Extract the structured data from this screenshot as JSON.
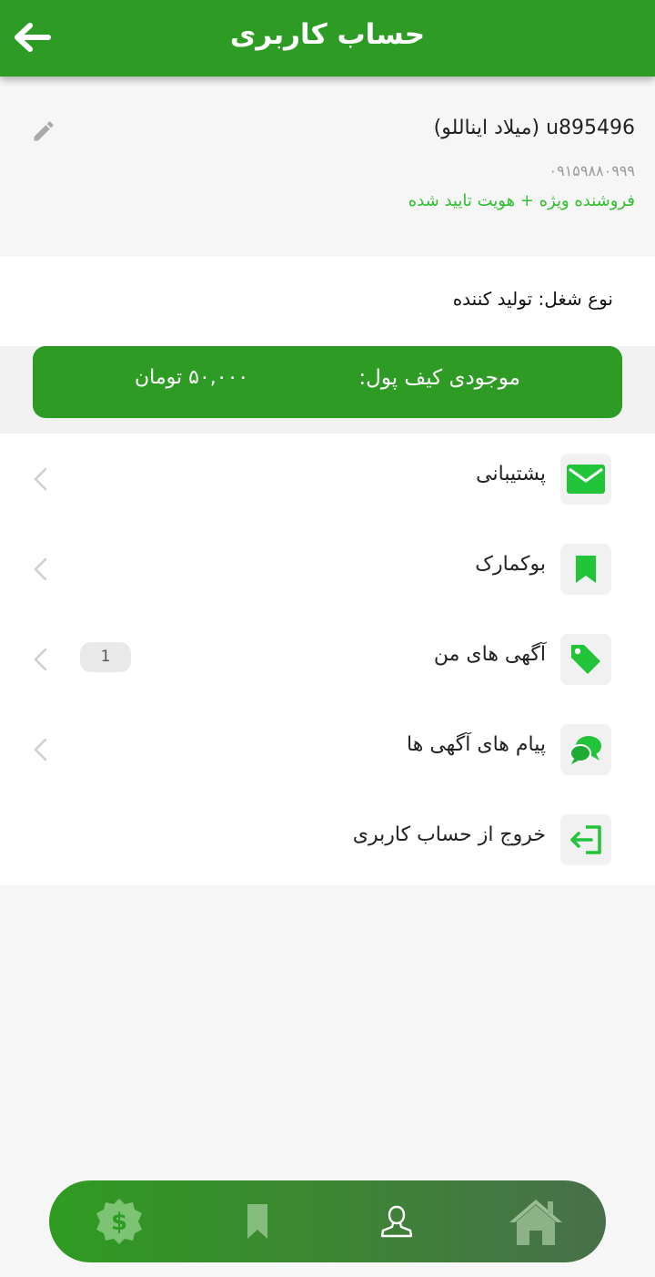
{
  "header": {
    "title": "حساب کاربری",
    "back_icon": "arrow-left-icon"
  },
  "profile": {
    "username_line": "u895496 (میلاد ایناللو)",
    "phone": "۰۹۱۵۹۸۸۰۹۹۹",
    "status": "فروشنده ویژه + هویت تایید شده",
    "edit_icon": "pencil-icon"
  },
  "job": {
    "text": "نوع شغل: تولید کننده"
  },
  "wallet": {
    "label": "موجودی کیف پول:",
    "amount": "۵۰,۰۰۰ تومان"
  },
  "menu": {
    "items": [
      {
        "label": "پشتیبانی",
        "icon": "mail-icon"
      },
      {
        "label": "بوکمارک",
        "icon": "bookmark-icon"
      },
      {
        "label": "آگهی های من",
        "icon": "tag-icon",
        "badge": "1"
      },
      {
        "label": "پیام های آگهی ها",
        "icon": "chat-bubbles-icon"
      },
      {
        "label": "خروج از حساب کاربری",
        "icon": "logout-icon"
      }
    ]
  },
  "bottom_nav": {
    "items": [
      "wallet-badge-icon",
      "bookmark-icon",
      "user-icon",
      "home-icon"
    ]
  },
  "colors": {
    "primary": "#2e9c24",
    "accent_green": "#2fbf2f",
    "icon_green": "#22c43a"
  }
}
